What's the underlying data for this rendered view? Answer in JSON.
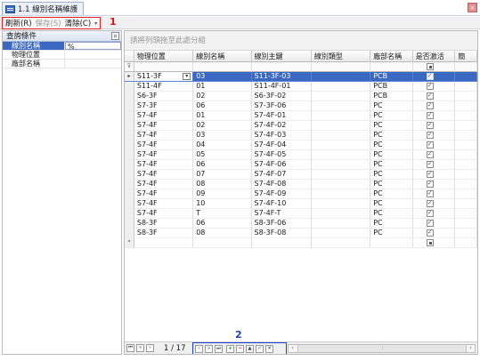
{
  "window": {
    "tab_title": "1.1 線別名稱維護",
    "close_glyph": "×"
  },
  "toolbar": {
    "refresh_label": "刷新(R)",
    "save_label": "保存(S)",
    "clear_label": "清除(C)",
    "dropdown_glyph": "▾"
  },
  "annotations": {
    "marker1": "1",
    "marker2": "2"
  },
  "query_pane": {
    "title": "查詢條件",
    "pin_glyph": "▫",
    "fields": [
      {
        "label": "線別名稱",
        "value": "%",
        "active": true
      },
      {
        "label": "物理位置",
        "value": "",
        "active": false
      },
      {
        "label": "廠部名稱",
        "value": "",
        "active": false
      }
    ]
  },
  "grid": {
    "group_hint": "請將列頭拖至此處分組",
    "columns": [
      "物理位置",
      "線別名稱",
      "線別主鍵",
      "線別類型",
      "廠部名稱",
      "是否激活",
      "簡"
    ],
    "filter_indicator": "⊽",
    "new_row_indicator": "*",
    "current_row_indicator": "▸",
    "combo_glyph": "▾",
    "rows": [
      {
        "location": "S11-3F",
        "line_name": "03",
        "line_key": "S11-3F-03",
        "line_type": "",
        "plant": "PCB",
        "active": true,
        "selected": true
      },
      {
        "location": "S11-4F",
        "line_name": "01",
        "line_key": "S11-4F-01",
        "line_type": "",
        "plant": "PCB",
        "active": true,
        "selected": false
      },
      {
        "location": "S6-3F",
        "line_name": "02",
        "line_key": "S6-3F-02",
        "line_type": "",
        "plant": "PCB",
        "active": true,
        "selected": false
      },
      {
        "location": "S7-3F",
        "line_name": "06",
        "line_key": "S7-3F-06",
        "line_type": "",
        "plant": "PC",
        "active": true,
        "selected": false
      },
      {
        "location": "S7-4F",
        "line_name": "01",
        "line_key": "S7-4F-01",
        "line_type": "",
        "plant": "PC",
        "active": true,
        "selected": false
      },
      {
        "location": "S7-4F",
        "line_name": "02",
        "line_key": "S7-4F-02",
        "line_type": "",
        "plant": "PC",
        "active": true,
        "selected": false
      },
      {
        "location": "S7-4F",
        "line_name": "03",
        "line_key": "S7-4F-03",
        "line_type": "",
        "plant": "PC",
        "active": true,
        "selected": false
      },
      {
        "location": "S7-4F",
        "line_name": "04",
        "line_key": "S7-4F-04",
        "line_type": "",
        "plant": "PC",
        "active": true,
        "selected": false
      },
      {
        "location": "S7-4F",
        "line_name": "05",
        "line_key": "S7-4F-05",
        "line_type": "",
        "plant": "PC",
        "active": true,
        "selected": false
      },
      {
        "location": "S7-4F",
        "line_name": "06",
        "line_key": "S7-4F-06",
        "line_type": "",
        "plant": "PC",
        "active": true,
        "selected": false
      },
      {
        "location": "S7-4F",
        "line_name": "07",
        "line_key": "S7-4F-07",
        "line_type": "",
        "plant": "PC",
        "active": true,
        "selected": false
      },
      {
        "location": "S7-4F",
        "line_name": "08",
        "line_key": "S7-4F-08",
        "line_type": "",
        "plant": "PC",
        "active": true,
        "selected": false
      },
      {
        "location": "S7-4F",
        "line_name": "09",
        "line_key": "S7-4F-09",
        "line_type": "",
        "plant": "PC",
        "active": true,
        "selected": false
      },
      {
        "location": "S7-4F",
        "line_name": "10",
        "line_key": "S7-4F-10",
        "line_type": "",
        "plant": "PC",
        "active": true,
        "selected": false
      },
      {
        "location": "S7-4F",
        "line_name": "T",
        "line_key": "S7-4F-T",
        "line_type": "",
        "plant": "PC",
        "active": true,
        "selected": false
      },
      {
        "location": "S8-3F",
        "line_name": "06",
        "line_key": "S8-3F-06",
        "line_type": "",
        "plant": "PC",
        "active": true,
        "selected": false
      },
      {
        "location": "S8-3F",
        "line_name": "08",
        "line_key": "S8-3F-08",
        "line_type": "",
        "plant": "PC",
        "active": true,
        "selected": false
      }
    ]
  },
  "pager": {
    "first_glyph": "⏮",
    "prev_page_glyph": "«",
    "prev_glyph": "‹",
    "page_info": "1 / 17",
    "next_glyph": "›",
    "next_page_glyph": "»",
    "last_glyph": "⏭",
    "add_glyph": "+",
    "delete_glyph": "−",
    "up_glyph": "▲",
    "confirm_glyph": "✓",
    "cancel_glyph": "✕",
    "scroll_left_glyph": "‹",
    "scroll_right_glyph": "›",
    "scroll_grip": "⦙"
  },
  "colors": {
    "selection": "#3b69c2",
    "annotation_red": "#dd1111",
    "annotation_blue": "#1f3fd0"
  }
}
